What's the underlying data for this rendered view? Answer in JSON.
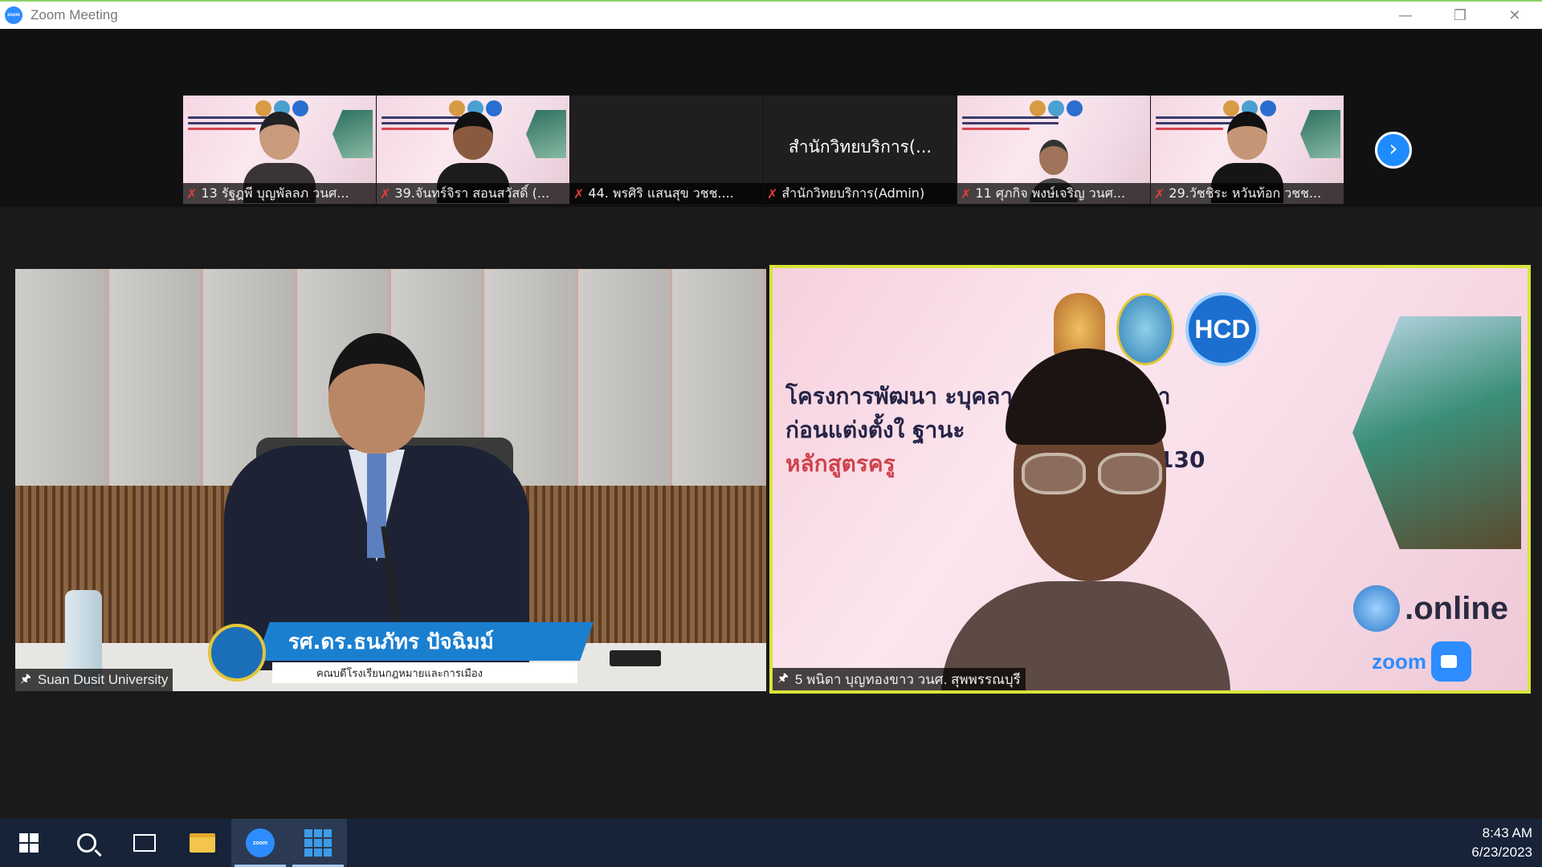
{
  "window": {
    "title": "Zoom Meeting",
    "controls": [
      "minimize",
      "restore",
      "close"
    ]
  },
  "thumbnails": [
    {
      "name": "13 รัฐฎพี บุญพัลลภ วนศ...",
      "muted": true,
      "video": "slide-person"
    },
    {
      "name": "39.จันทร์จิรา สอนสวัสดิ์ (...",
      "muted": true,
      "video": "slide-person"
    },
    {
      "name": "44. พรศิริ แสนสุข วชช....",
      "muted": true,
      "video": "off"
    },
    {
      "name": "สำนักวิทยบริการ(Admin)",
      "muted": true,
      "video": "off",
      "center_label": "สำนักวิทยบริการ(..."
    },
    {
      "name": "11 ศุภกิจ พงษ์เจริญ วนศ...",
      "muted": true,
      "video": "slide-person"
    },
    {
      "name": "29.วัชชิระ หวันท้อก วชช...",
      "muted": true,
      "video": "slide-person"
    }
  ],
  "main_tiles": {
    "left": {
      "label": "Suan Dusit University",
      "lower_third_name": "รศ.ดร.ธนภัทร ปัจฉิมม์",
      "lower_third_sub": "คณบดีโรงเรียนกฎหมายและการเมือง"
    },
    "right": {
      "label": "5 พนิดา บุญทองขาว วนศ. สุพพรรณบุรี",
      "slide_logo_text": "HCD",
      "slide_line1": "โครงการพัฒนา                     ะบุคลากรทางการศึกษา",
      "slide_line2": "ก่อนแต่งตั้งใ                          ฐานะ",
      "slide_line3_red": "หลักสูตรครู",
      "slide_line3_num": "130",
      "online_text": ".online",
      "zoom_text": "zoom",
      "active_speaker_color": "#d7e43a"
    }
  },
  "taskbar": {
    "items": [
      "start-icon",
      "search-icon",
      "task-view-icon",
      "file-explorer-icon",
      "zoom-app-icon",
      "app-grid-icon"
    ],
    "zoom_icon_text": "zoom",
    "time": "8:43 AM",
    "date": "6/23/2023"
  },
  "colors": {
    "accent": "#2d8cff",
    "muted": "#e43c3c",
    "taskbar": "#162338"
  }
}
